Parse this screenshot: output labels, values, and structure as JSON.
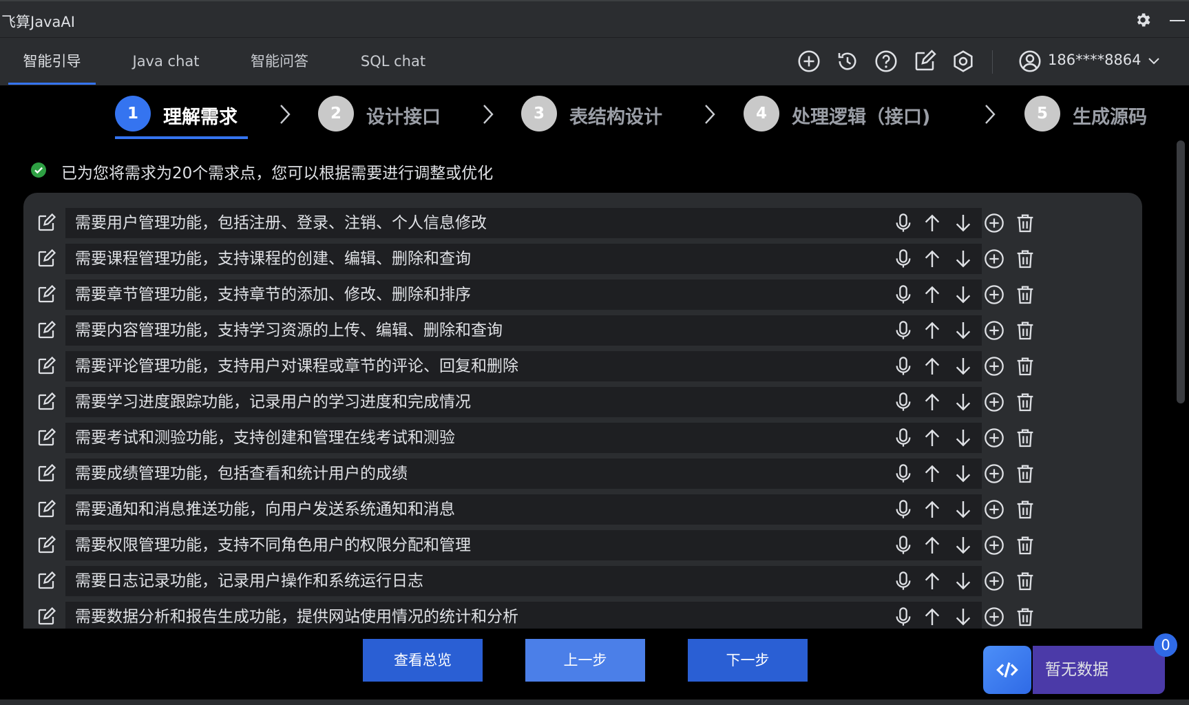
{
  "app": {
    "title": "飞算JavaAI"
  },
  "nav": {
    "tabs": [
      {
        "label": "智能引导",
        "active": true
      },
      {
        "label": "Java chat"
      },
      {
        "label": "智能问答"
      },
      {
        "label": "SQL chat"
      }
    ],
    "tool_icons": [
      "plus-circle-icon",
      "history-icon",
      "help-icon",
      "edit-icon",
      "settings-hex-icon"
    ],
    "user": {
      "phone": "186****8864"
    }
  },
  "steps": [
    {
      "num": "1",
      "label": "理解需求",
      "active": true
    },
    {
      "num": "2",
      "label": "设计接口"
    },
    {
      "num": "3",
      "label": "表结构设计"
    },
    {
      "num": "4",
      "label": "处理逻辑（接口)"
    },
    {
      "num": "5",
      "label": "生成源码"
    }
  ],
  "status": {
    "text": "已为您将需求为20个需求点，您可以根据需要进行调整或优化",
    "color": "#2ea043"
  },
  "requirements": [
    "需要用户管理功能，包括注册、登录、注销、个人信息修改",
    "需要课程管理功能，支持课程的创建、编辑、删除和查询",
    "需要章节管理功能，支持章节的添加、修改、删除和排序",
    "需要内容管理功能，支持学习资源的上传、编辑、删除和查询",
    "需要评论管理功能，支持用户对课程或章节的评论、回复和删除",
    "需要学习进度跟踪功能，记录用户的学习进度和完成情况",
    "需要考试和测验功能，支持创建和管理在线考试和测验",
    "需要成绩管理功能，包括查看和统计用户的成绩",
    "需要通知和消息推送功能，向用户发送系统通知和消息",
    "需要权限管理功能，支持不同角色用户的权限分配和管理",
    "需要日志记录功能，记录用户操作和系统运行日志",
    "需要数据分析和报告生成功能，提供网站使用情况的统计和分析"
  ],
  "buttons": {
    "overview": "查看总览",
    "prev": "上一步",
    "next": "下一步"
  },
  "code_widget": {
    "label": "暂无数据",
    "badge": "0"
  },
  "colors": {
    "accent": "#3574f0",
    "button": "#2a5fd4",
    "panel": "#2b2d30"
  }
}
